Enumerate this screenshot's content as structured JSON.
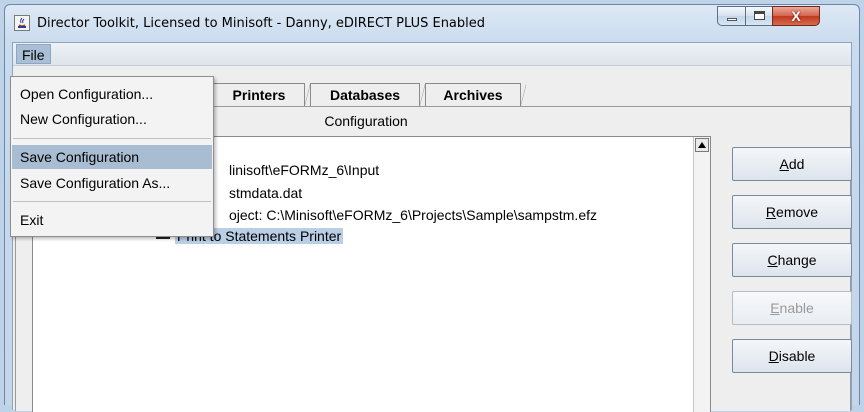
{
  "window": {
    "title": "Director Toolkit, Licensed to Minisoft - Danny, eDIRECT PLUS Enabled",
    "minimize_icon": "minimize-icon",
    "maximize_icon": "maximize-icon",
    "close_glyph": "X"
  },
  "menubar": {
    "file_label": "File"
  },
  "file_menu": {
    "items": [
      {
        "label": "Open Configuration..."
      },
      {
        "label": "New Configuration..."
      },
      {
        "label": "Save Configuration",
        "highlighted": true
      },
      {
        "label": "Save Configuration As..."
      },
      {
        "label": "Exit"
      }
    ]
  },
  "tabs": [
    {
      "label": "Printers"
    },
    {
      "label": "Databases"
    },
    {
      "label": "Archives"
    }
  ],
  "config": {
    "header": "Configuration",
    "tree_lines": [
      "linisoft\\eFORMz_6\\Input",
      "stmdata.dat",
      "oject: C:\\Minisoft\\eFORMz_6\\Projects\\Sample\\sampstm.efz"
    ],
    "selected_node": "Print to Statements Printer"
  },
  "buttons": {
    "add": {
      "mnemonic": "A",
      "rest": "dd"
    },
    "remove": {
      "mnemonic": "R",
      "rest": "emove"
    },
    "change": {
      "mnemonic": "C",
      "rest": "hange"
    },
    "enable": {
      "mnemonic": "E",
      "rest": "nable"
    },
    "disable": {
      "mnemonic": "D",
      "rest": "isable"
    }
  },
  "colors": {
    "menu_highlight": "#a8bcd2",
    "selection": "#b8cfe5",
    "title_gradient": "#c9dbee"
  }
}
